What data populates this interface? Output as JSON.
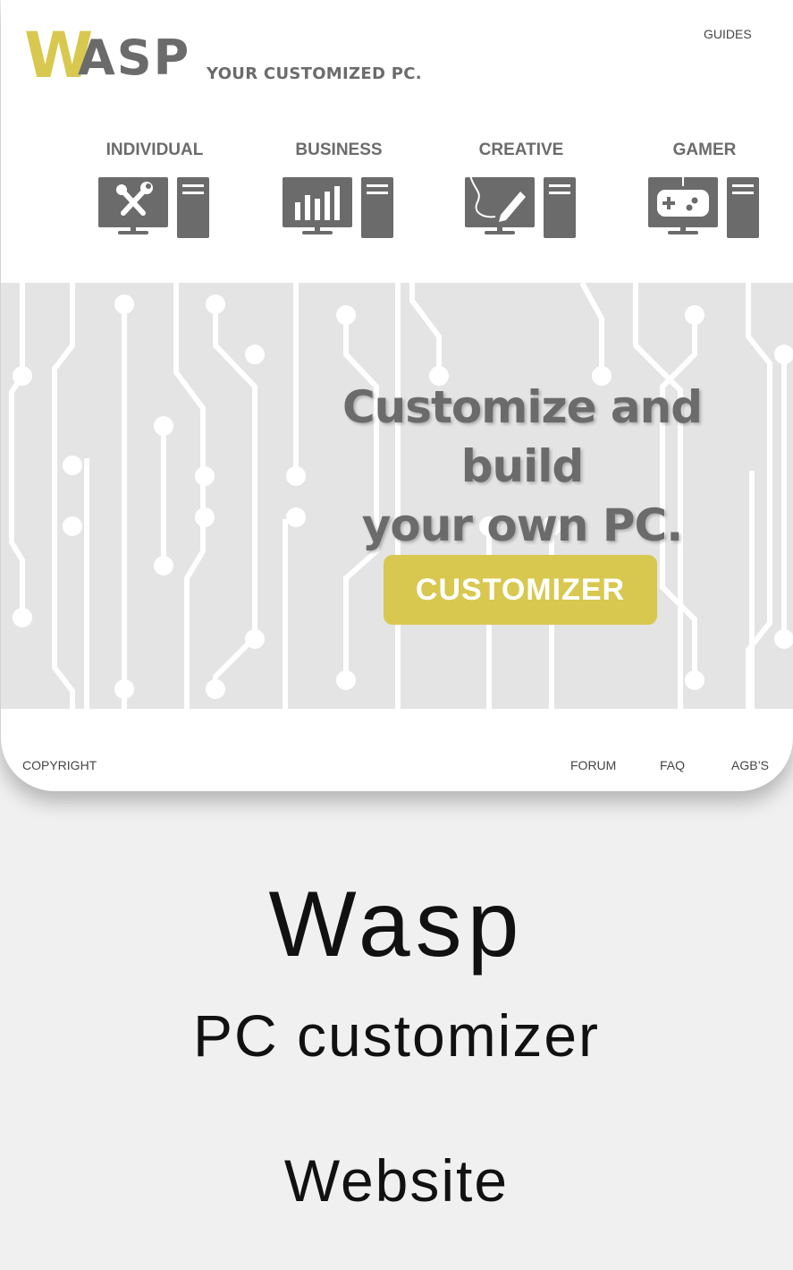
{
  "header": {
    "logo_letter": "W",
    "logo_rest": "ASP",
    "tagline": "YOUR CUSTOMIZED PC.",
    "nav_guides": "GUIDES"
  },
  "categories": [
    {
      "label": "INDIVIDUAL",
      "icon": "tools-computer-icon"
    },
    {
      "label": "BUSINESS",
      "icon": "chart-computer-icon"
    },
    {
      "label": "CREATIVE",
      "icon": "pen-computer-icon"
    },
    {
      "label": "GAMER",
      "icon": "gamepad-computer-icon"
    }
  ],
  "hero": {
    "title_line1": "Customize and build",
    "title_line2": "your own PC.",
    "cta_label": "CUSTOMIZER"
  },
  "footer": {
    "copyright": "COPYRIGHT",
    "forum": "FORUM",
    "faq": "FAQ",
    "agb": "AGB’S"
  },
  "caption": {
    "title": "Wasp",
    "subtitle": "PC customizer",
    "type": "Website"
  },
  "colors": {
    "accent": "#d8c84f",
    "icon_gray": "#6b6b6b",
    "hero_bg": "#e4e4e4",
    "page_bg": "#f0f0f0"
  }
}
